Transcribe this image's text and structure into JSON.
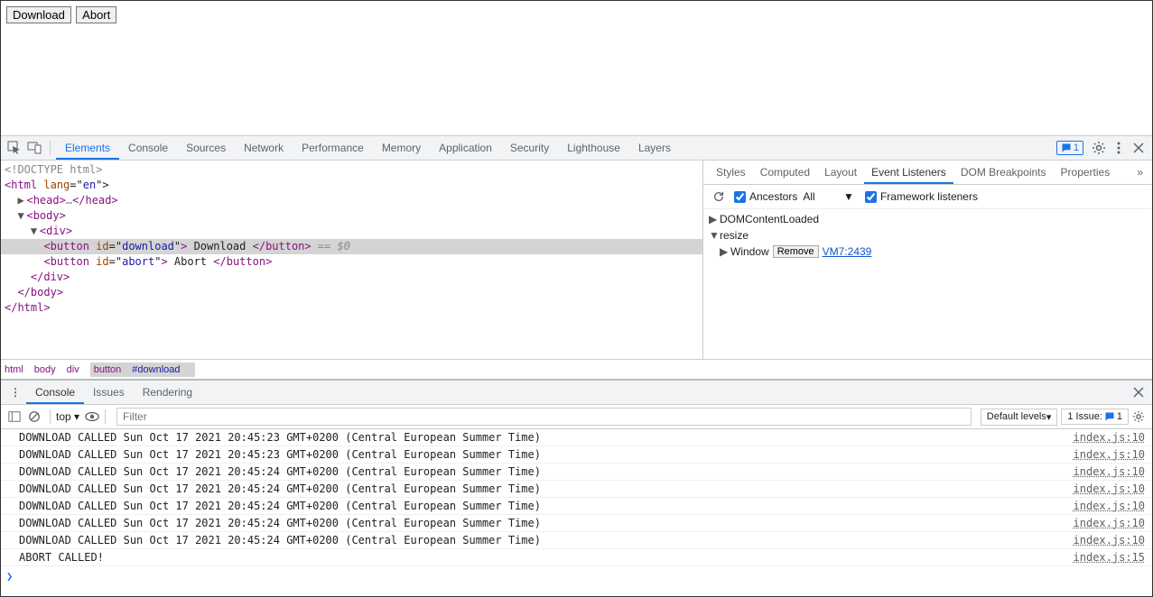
{
  "page": {
    "download_label": "Download",
    "abort_label": "Abort"
  },
  "main_tabs": [
    "Elements",
    "Console",
    "Sources",
    "Network",
    "Performance",
    "Memory",
    "Application",
    "Security",
    "Lighthouse",
    "Layers"
  ],
  "main_active": "Elements",
  "messages_badge": "1",
  "dom": {
    "l0": "<!DOCTYPE html>",
    "l1_open": "<",
    "l1_tag": "html",
    "l1_attr": " lang",
    "l1_eq": "=\"",
    "l1_val": "en",
    "l1_close": "\">",
    "l2_arrow": "▶ ",
    "l2_open": "<",
    "l2_tag": "head",
    "l2_gt": ">",
    "l2_ell": "…",
    "l2_close": "</",
    "l2_closetag": "head",
    "l2_end": ">",
    "l3_arrow": "▼ ",
    "l3_open": "<",
    "l3_tag": "body",
    "l3_gt": ">",
    "l4_arrow": "▼ ",
    "l4_open": "<",
    "l4_tag": "div",
    "l4_gt": ">",
    "sel_indent": "      ",
    "sel_open": "<",
    "sel_tag": "button",
    "sel_attr": " id",
    "sel_eq": "=\"",
    "sel_val": "download",
    "sel_q": "\"",
    "sel_gt": ">",
    "sel_text": " Download ",
    "sel_close": "</",
    "sel_closetag": "button",
    "sel_end": ">",
    "sel_eq0": " == $0",
    "l6_indent": "      ",
    "l6_open": "<",
    "l6_tag": "button",
    "l6_attr": " id",
    "l6_eq": "=\"",
    "l6_val": "abort",
    "l6_q": "\"",
    "l6_gt": ">",
    "l6_text": " Abort ",
    "l6_close": "</",
    "l6_closetag": "button",
    "l6_end": ">",
    "l7_indent": "    ",
    "l7": "</",
    "l7_tag": "div",
    "l7_end": ">",
    "l8_indent": "  ",
    "l8": "</",
    "l8_tag": "body",
    "l8_end": ">",
    "l9": "</",
    "l9_tag": "html",
    "l9_end": ">"
  },
  "breadcrumb": {
    "b0": "html",
    "b1": "body",
    "b2": "div",
    "b3_tag": "button",
    "b3_hash": "#download"
  },
  "side_tabs": [
    "Styles",
    "Computed",
    "Layout",
    "Event Listeners",
    "DOM Breakpoints",
    "Properties"
  ],
  "side_active": "Event Listeners",
  "listener_toolbar": {
    "ancestors": "Ancestors",
    "scope": "All",
    "framework": "Framework listeners"
  },
  "events": {
    "e0": "DOMContentLoaded",
    "e1": "resize",
    "e1_target": "Window",
    "e1_remove": "Remove",
    "e1_link": "VM7:2439"
  },
  "drawer_tabs": [
    "Console",
    "Issues",
    "Rendering"
  ],
  "drawer_active": "Console",
  "console_toolbar": {
    "context": "top",
    "filter_placeholder": "Filter",
    "levels": "Default levels",
    "issues": "1 Issue:",
    "issues_count": "1"
  },
  "logs": [
    {
      "msg": "DOWNLOAD CALLED Sun Oct 17 2021 20:45:23 GMT+0200 (Central European Summer Time)",
      "src": "index.js:10"
    },
    {
      "msg": "DOWNLOAD CALLED Sun Oct 17 2021 20:45:23 GMT+0200 (Central European Summer Time)",
      "src": "index.js:10"
    },
    {
      "msg": "DOWNLOAD CALLED Sun Oct 17 2021 20:45:24 GMT+0200 (Central European Summer Time)",
      "src": "index.js:10"
    },
    {
      "msg": "DOWNLOAD CALLED Sun Oct 17 2021 20:45:24 GMT+0200 (Central European Summer Time)",
      "src": "index.js:10"
    },
    {
      "msg": "DOWNLOAD CALLED Sun Oct 17 2021 20:45:24 GMT+0200 (Central European Summer Time)",
      "src": "index.js:10"
    },
    {
      "msg": "DOWNLOAD CALLED Sun Oct 17 2021 20:45:24 GMT+0200 (Central European Summer Time)",
      "src": "index.js:10"
    },
    {
      "msg": "DOWNLOAD CALLED Sun Oct 17 2021 20:45:24 GMT+0200 (Central European Summer Time)",
      "src": "index.js:10"
    },
    {
      "msg": "ABORT CALLED!",
      "src": "index.js:15"
    }
  ],
  "prompt": "❯"
}
